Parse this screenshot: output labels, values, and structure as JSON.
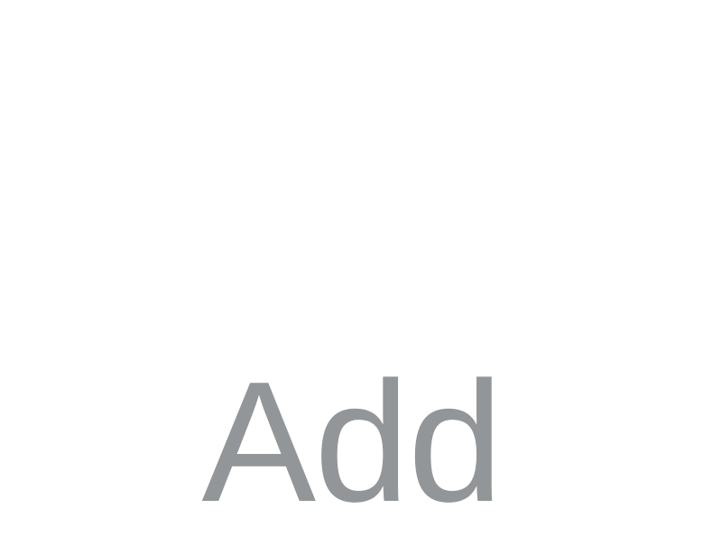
{
  "add_button": {
    "label": "Add",
    "text_color": "#939698"
  },
  "page": {
    "background_color": "#ffffff"
  }
}
